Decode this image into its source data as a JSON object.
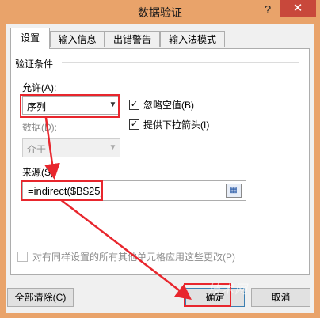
{
  "window": {
    "title": "数据验证",
    "help_glyph": "?",
    "close_glyph": "✕"
  },
  "tabs": [
    {
      "label": "设置",
      "active": true
    },
    {
      "label": "输入信息",
      "active": false
    },
    {
      "label": "出错警告",
      "active": false
    },
    {
      "label": "输入法模式",
      "active": false
    }
  ],
  "settings": {
    "group_label": "验证条件",
    "allow_label": "允许(A):",
    "allow_value": "序列",
    "data_label": "数据(D):",
    "data_value": "介于",
    "ignore_blank_label": "忽略空值(B)",
    "ignore_blank_checked": true,
    "dropdown_label": "提供下拉箭头(I)",
    "dropdown_checked": true,
    "source_label": "来源(S):",
    "source_value": "=indirect($B$25)",
    "apply_all_label": "对有同样设置的所有其他单元格应用这些更改(P)",
    "apply_all_checked": false
  },
  "buttons": {
    "clear_all": "全部清除(C)",
    "ok": "确定",
    "cancel": "取消"
  },
  "colors": {
    "titlebar": "#e9a36a",
    "close": "#c8483b",
    "highlight": "#e8262d"
  }
}
